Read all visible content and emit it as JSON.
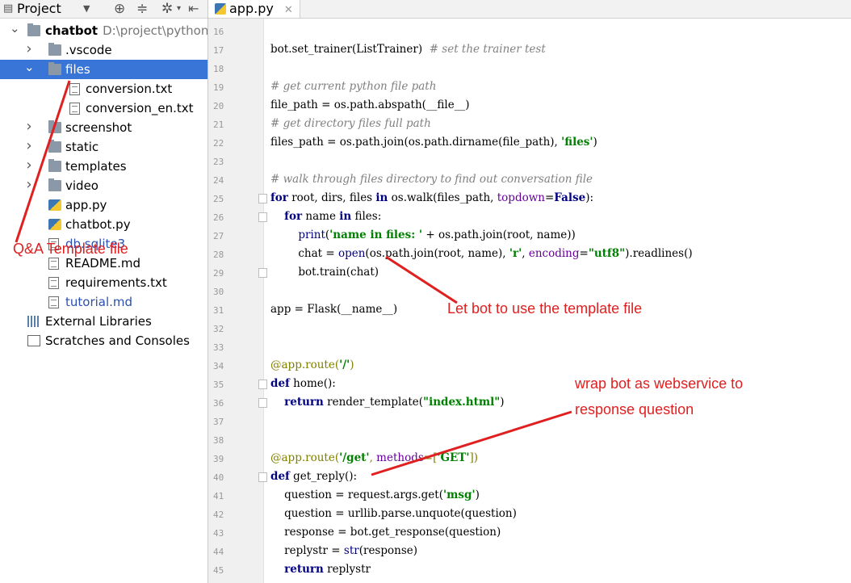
{
  "panel": {
    "title": "Project",
    "tree": [
      {
        "label": "chatbot",
        "path": "D:\\project\\python",
        "depth": 0,
        "expanded": true,
        "icon": "folder-icon",
        "bold": true
      },
      {
        "label": ".vscode",
        "depth": 1,
        "expanded": false,
        "icon": "folder-icon"
      },
      {
        "label": "files",
        "depth": 1,
        "expanded": true,
        "icon": "folder-icon",
        "selected": true
      },
      {
        "label": "conversion.txt",
        "depth": 2,
        "icon": "text-file-icon"
      },
      {
        "label": "conversion_en.txt",
        "depth": 2,
        "icon": "text-file-icon"
      },
      {
        "label": "screenshot",
        "depth": 1,
        "expanded": false,
        "icon": "folder-icon"
      },
      {
        "label": "static",
        "depth": 1,
        "expanded": false,
        "icon": "folder-icon"
      },
      {
        "label": "templates",
        "depth": 1,
        "expanded": false,
        "icon": "folder-icon"
      },
      {
        "label": "video",
        "depth": 1,
        "expanded": false,
        "icon": "folder-icon"
      },
      {
        "label": "app.py",
        "depth": 1,
        "icon": "python-file-icon"
      },
      {
        "label": "chatbot.py",
        "depth": 1,
        "icon": "python-file-icon"
      },
      {
        "label": "db.sqlite3",
        "depth": 1,
        "icon": "db-file-icon",
        "color": "#2a4fb0"
      },
      {
        "label": "README.md",
        "depth": 1,
        "icon": "text-file-icon"
      },
      {
        "label": "requirements.txt",
        "depth": 1,
        "icon": "text-file-icon"
      },
      {
        "label": "tutorial.md",
        "depth": 1,
        "icon": "text-file-icon",
        "color": "#2a4fb0"
      },
      {
        "label": "External Libraries",
        "depth": 0,
        "icon": "library-icon"
      },
      {
        "label": "Scratches and Consoles",
        "depth": 0,
        "icon": "scratch-icon"
      }
    ]
  },
  "editor": {
    "tab_label": "app.py",
    "lines": [
      {
        "n": "16",
        "t": []
      },
      {
        "n": "17",
        "t": [
          [
            "bot.set_trainer(ListTrainer)  ",
            ""
          ],
          [
            "# set the trainer test",
            "cm"
          ]
        ]
      },
      {
        "n": "18",
        "t": []
      },
      {
        "n": "19",
        "t": [
          [
            "# get current python file path",
            "cm"
          ]
        ]
      },
      {
        "n": "20",
        "t": [
          [
            "file_path = os.path.abspath(__file__)",
            ""
          ]
        ]
      },
      {
        "n": "21",
        "t": [
          [
            "# get directory files full path",
            "cm"
          ]
        ]
      },
      {
        "n": "22",
        "t": [
          [
            "files_path = os.path.join(os.path.dirname(file_path), ",
            ""
          ],
          [
            "'files'",
            "st"
          ],
          [
            ")",
            ""
          ]
        ]
      },
      {
        "n": "23",
        "t": []
      },
      {
        "n": "24",
        "t": [
          [
            "# walk through files directory to find out conversation file",
            "cm"
          ]
        ]
      },
      {
        "n": "25",
        "t": [
          [
            "for",
            "kw"
          ],
          [
            " root, dirs, files ",
            ""
          ],
          [
            "in",
            "kw"
          ],
          [
            " os.walk(files_path, ",
            ""
          ],
          [
            "topdown",
            "nm"
          ],
          [
            "=",
            ""
          ],
          [
            "False",
            "kw"
          ],
          [
            "):",
            ""
          ]
        ],
        "fold": true
      },
      {
        "n": "26",
        "t": [
          [
            "    ",
            ""
          ],
          [
            "for",
            "kw"
          ],
          [
            " name ",
            ""
          ],
          [
            "in",
            "kw"
          ],
          [
            " files:",
            ""
          ]
        ],
        "fold": true
      },
      {
        "n": "27",
        "t": [
          [
            "        ",
            ""
          ],
          [
            "print",
            "bi"
          ],
          [
            "(",
            ""
          ],
          [
            "'name in files: '",
            "st"
          ],
          [
            " + os.path.join(root, name))",
            ""
          ]
        ]
      },
      {
        "n": "28",
        "t": [
          [
            "        chat = ",
            ""
          ],
          [
            "open",
            "bi"
          ],
          [
            "(os.path.join(root, name), ",
            ""
          ],
          [
            "'r'",
            "st"
          ],
          [
            ", ",
            ""
          ],
          [
            "encoding",
            "nm"
          ],
          [
            "=",
            ""
          ],
          [
            "\"utf8\"",
            "st"
          ],
          [
            ").readlines()",
            ""
          ]
        ]
      },
      {
        "n": "29",
        "t": [
          [
            "        bot.train(chat)",
            ""
          ]
        ],
        "fold": true
      },
      {
        "n": "30",
        "t": []
      },
      {
        "n": "31",
        "t": [
          [
            "app = Flask(__name__)",
            ""
          ]
        ]
      },
      {
        "n": "32",
        "t": []
      },
      {
        "n": "33",
        "t": []
      },
      {
        "n": "34",
        "t": [
          [
            "@app.route(",
            "dc"
          ],
          [
            "'/'",
            "st"
          ],
          [
            ")",
            "dc"
          ]
        ]
      },
      {
        "n": "35",
        "t": [
          [
            "def",
            "kw"
          ],
          [
            " home():",
            ""
          ]
        ],
        "fold": true
      },
      {
        "n": "36",
        "t": [
          [
            "    ",
            ""
          ],
          [
            "return",
            "kw"
          ],
          [
            " render_template(",
            ""
          ],
          [
            "\"index.html\"",
            "st"
          ],
          [
            ")",
            ""
          ]
        ],
        "fold": true
      },
      {
        "n": "37",
        "t": []
      },
      {
        "n": "38",
        "t": []
      },
      {
        "n": "39",
        "t": [
          [
            "@app.route(",
            "dc"
          ],
          [
            "'/get'",
            "st"
          ],
          [
            ", ",
            "dc"
          ],
          [
            "methods",
            "nm"
          ],
          [
            "=[",
            "dc"
          ],
          [
            "'GET'",
            "st"
          ],
          [
            "])",
            "dc"
          ]
        ]
      },
      {
        "n": "40",
        "t": [
          [
            "def",
            "kw"
          ],
          [
            " get_reply():",
            ""
          ]
        ],
        "fold": true
      },
      {
        "n": "41",
        "t": [
          [
            "    question = request.args.get(",
            ""
          ],
          [
            "'msg'",
            "st"
          ],
          [
            ")",
            ""
          ]
        ]
      },
      {
        "n": "42",
        "t": [
          [
            "    question = urllib.parse.unquote(question)",
            ""
          ]
        ]
      },
      {
        "n": "43",
        "t": [
          [
            "    response = bot.get_response(question)",
            ""
          ]
        ]
      },
      {
        "n": "44",
        "t": [
          [
            "    replystr = ",
            ""
          ],
          [
            "str",
            "bi"
          ],
          [
            "(response)",
            ""
          ]
        ]
      },
      {
        "n": "45",
        "t": [
          [
            "    ",
            ""
          ],
          [
            "return",
            "kw"
          ],
          [
            " replystr",
            ""
          ]
        ]
      }
    ]
  },
  "annotations": {
    "qa_label": "Q&A Template file",
    "template_label": "Let bot to use the template file",
    "webservice_line1": "wrap bot as webservice to",
    "webservice_line2": "response question",
    "color": "#e02020"
  }
}
